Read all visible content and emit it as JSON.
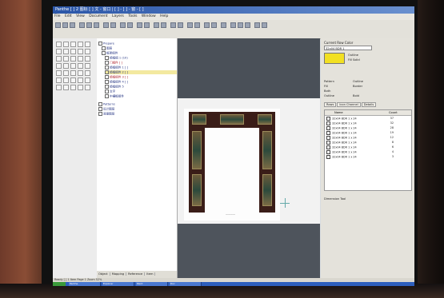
{
  "window": {
    "title": "Panthe [ ] 2 图标 [ ] 文 - 窗口 | [ ] - [ ] - 窗 - [ ]"
  },
  "menu": [
    "File",
    "Edit",
    "View",
    "Document",
    "Layers",
    "Tools",
    "Window",
    "Help"
  ],
  "tree": {
    "items": [
      {
        "label": "Prepare",
        "style": "normal"
      },
      {
        "label": "图层",
        "style": "normal"
      },
      {
        "label": "框架组件",
        "style": "normal"
      },
      {
        "label": "镜框组 1 (10)",
        "style": "normal"
      },
      {
        "label": "门组件 [ ]",
        "style": "red"
      },
      {
        "label": "镜框组件 1 [ ]",
        "style": "normal"
      },
      {
        "label": "镜框组件 2 [ ]",
        "style": "highlight"
      },
      {
        "label": "镜框组件 3 [ ]",
        "style": "red"
      },
      {
        "label": "镜框组件 4 [ ]",
        "style": "normal"
      },
      {
        "label": "镜框组件 5",
        "style": "normal"
      },
      {
        "label": "文字",
        "style": "normal"
      },
      {
        "label": "中横框组件",
        "style": "normal"
      },
      {
        "label": "Patterns",
        "style": "normal"
      },
      {
        "label": "设计图层",
        "style": "normal"
      },
      {
        "label": "背景图层",
        "style": "normal"
      }
    ],
    "tabs": [
      "Object",
      "Mapping",
      "Reference",
      "Item"
    ]
  },
  "right_panel": {
    "title": "Current Row Color",
    "selected_value": "32x04 BDR 1",
    "swatch_color": "#f2e022",
    "options": [
      "Outline",
      "Fill Solid",
      "Outline",
      "Bold"
    ],
    "radio_options": [
      "Pattern",
      "Outline",
      "Fill",
      "Border",
      "Both"
    ],
    "tabs": [
      "Rows",
      "Icon Channel",
      "Details"
    ],
    "list_header": {
      "col1": "Name",
      "col2": "Count"
    },
    "rows": [
      {
        "label": "32x04 BDR 1 x 24",
        "count": "37"
      },
      {
        "label": "32x04 BDR 1 x 24",
        "count": "32"
      },
      {
        "label": "32x04 BDR 1 x 24",
        "count": "28"
      },
      {
        "label": "32x04 BDR 1 x 24",
        "count": "19"
      },
      {
        "label": "32x04 BDR 1 x 24",
        "count": "12"
      },
      {
        "label": "32x04 BDR 1 x 24",
        "count": "8"
      },
      {
        "label": "32x04 BDR 1 x 24",
        "count": "6"
      },
      {
        "label": "32x04 BDR 1 x 24",
        "count": "4"
      },
      {
        "label": "32x04 BDR 1 x 24",
        "count": "3"
      }
    ],
    "bottom_label": "Dimension Tool"
  },
  "canvas": {
    "caption": "————"
  },
  "status": {
    "text": "Ready   [ ] 1 Item  Page 1  Zoom 52%"
  },
  "taskbar": {
    "items": [
      "start",
      "Panthe",
      "Explorer",
      "Paint",
      "Doc"
    ]
  }
}
